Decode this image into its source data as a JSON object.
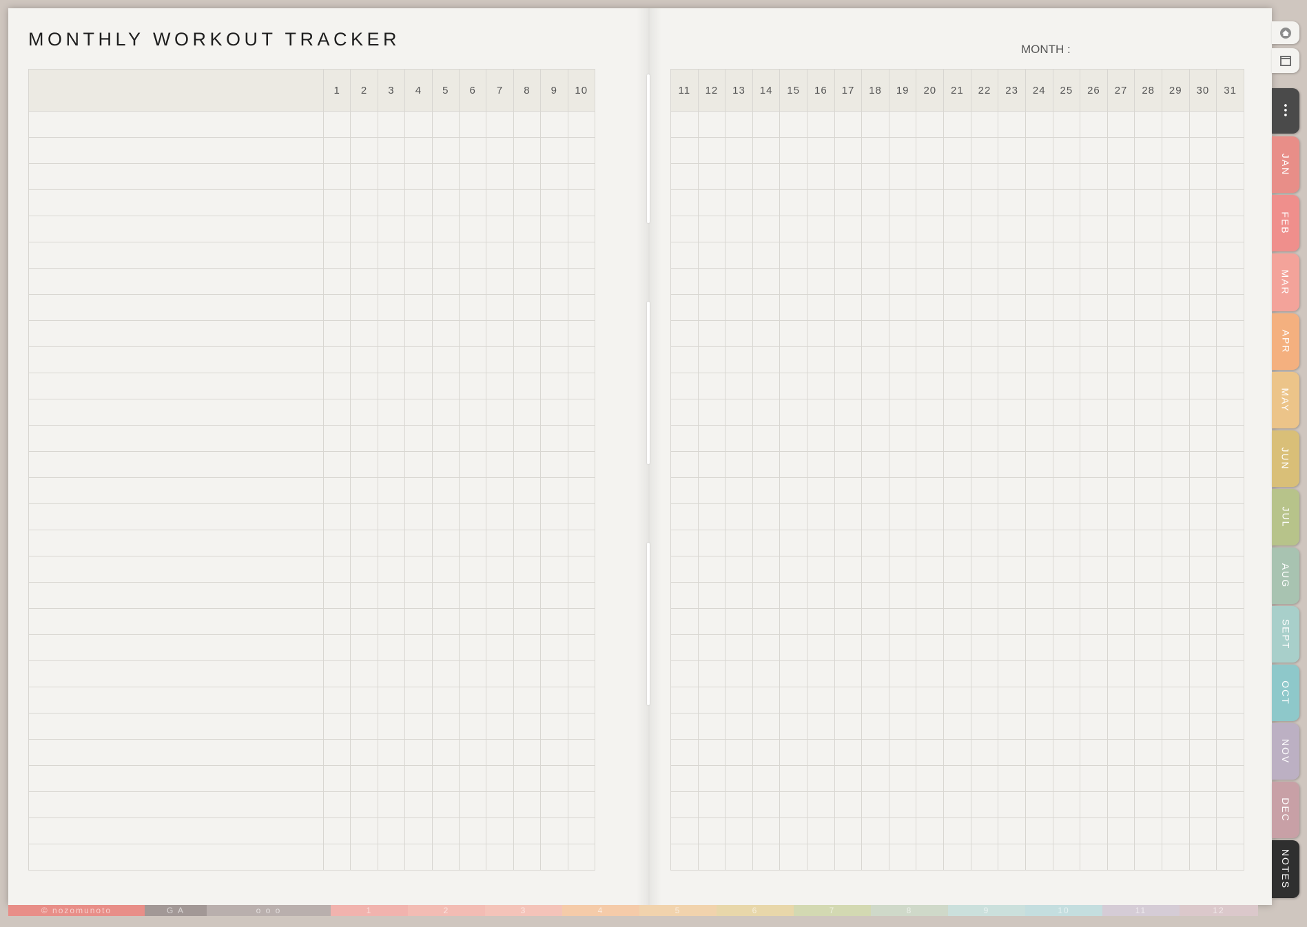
{
  "title": "MONTHLY WORKOUT TRACKER",
  "month_label": "MONTH :",
  "left_days": [
    "1",
    "2",
    "3",
    "4",
    "5",
    "6",
    "7",
    "8",
    "9",
    "10"
  ],
  "right_days": [
    "11",
    "12",
    "13",
    "14",
    "15",
    "16",
    "17",
    "18",
    "19",
    "20",
    "21",
    "22",
    "23",
    "24",
    "25",
    "26",
    "27",
    "28",
    "29",
    "30",
    "31"
  ],
  "row_count": 29,
  "side_tabs": [
    {
      "label": "•••",
      "color": "#4a4a4a"
    },
    {
      "label": "JAN",
      "color": "#e88e88"
    },
    {
      "label": "FEB",
      "color": "#ef8f8c"
    },
    {
      "label": "MAR",
      "color": "#f3a39a"
    },
    {
      "label": "APR",
      "color": "#f4b07f"
    },
    {
      "label": "MAY",
      "color": "#ecc489"
    },
    {
      "label": "JUN",
      "color": "#d9bf78"
    },
    {
      "label": "JUL",
      "color": "#b7c38a"
    },
    {
      "label": "AUG",
      "color": "#a8c3b1"
    },
    {
      "label": "SEPT",
      "color": "#a8cfca"
    },
    {
      "label": "OCT",
      "color": "#8ec8ca"
    },
    {
      "label": "NOV",
      "color": "#bcb0c3"
    },
    {
      "label": "DEC",
      "color": "#c8a0a6"
    },
    {
      "label": "NOTES",
      "color": "#2f2f2f"
    }
  ],
  "bottom_strip": [
    {
      "label": "© nozomunoto",
      "color": "#e88e88"
    },
    {
      "label": "G   A",
      "color": "#a29896"
    },
    {
      "label": "o       o o",
      "color": "#b9afad"
    },
    {
      "label": "1",
      "color": "#f1b3ae"
    },
    {
      "label": "2",
      "color": "#f3bcb4"
    },
    {
      "label": "3",
      "color": "#f4c3b9"
    },
    {
      "label": "4",
      "color": "#f5cba9"
    },
    {
      "label": "5",
      "color": "#f1d3ad"
    },
    {
      "label": "6",
      "color": "#e8d7aa"
    },
    {
      "label": "7",
      "color": "#d3d9b2"
    },
    {
      "label": "8",
      "color": "#cfd9c9"
    },
    {
      "label": "9",
      "color": "#cbe0dc"
    },
    {
      "label": "10",
      "color": "#c4dedf"
    },
    {
      "label": "11",
      "color": "#d5ccd6"
    },
    {
      "label": "12",
      "color": "#dbc8cb"
    }
  ]
}
